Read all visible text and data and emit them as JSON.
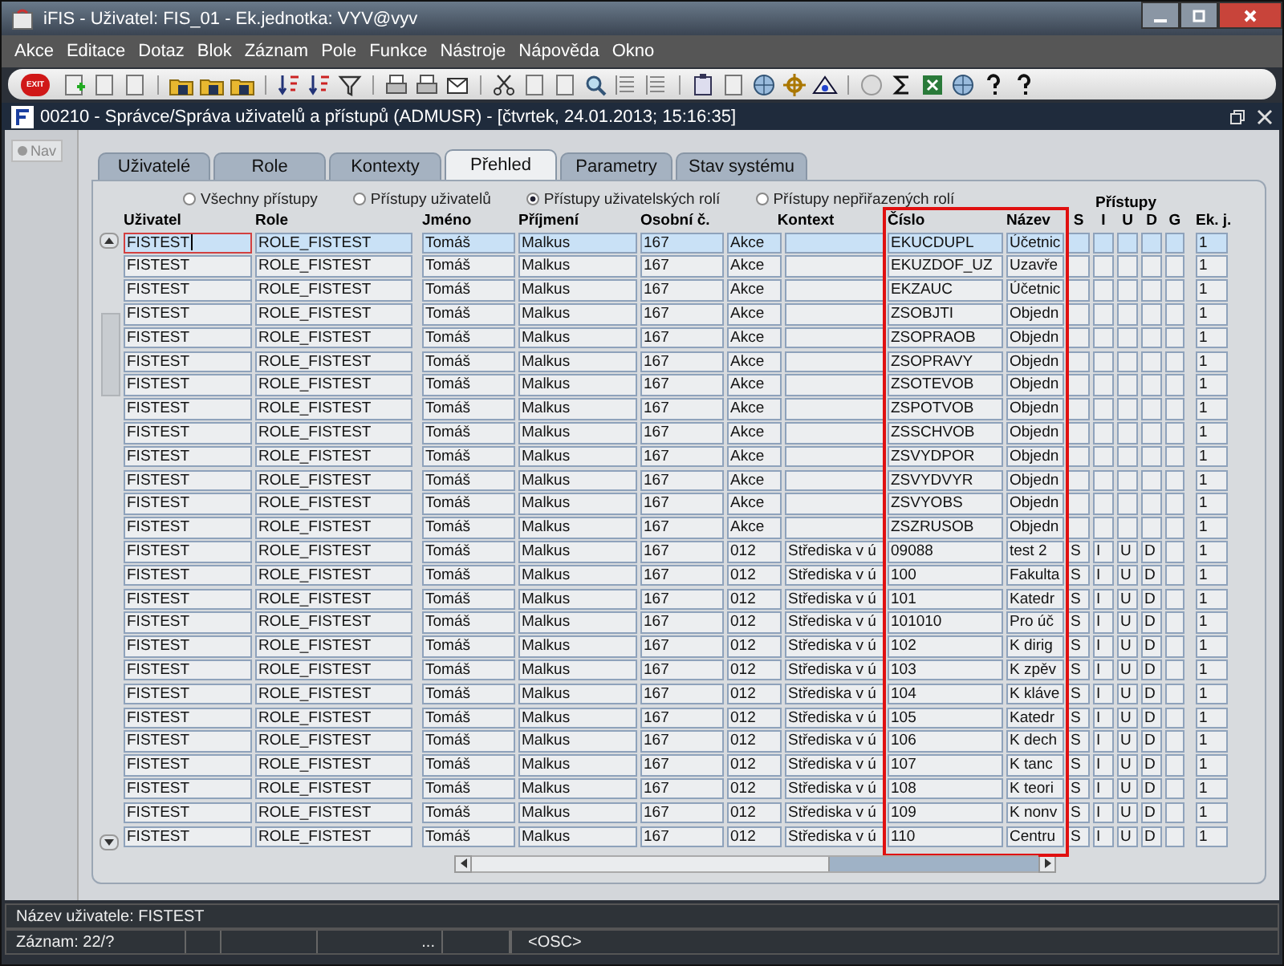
{
  "window": {
    "title": "iFIS - Uživatel: FIS_01 - Ek.jednotka: VYV@vyv"
  },
  "menu": [
    "Akce",
    "Editace",
    "Dotaz",
    "Blok",
    "Záznam",
    "Pole",
    "Funkce",
    "Nástroje",
    "Nápověda",
    "Okno"
  ],
  "toolbar": {
    "exit_label": "EXIT"
  },
  "form": {
    "title": "00210 - Správce/Správa uživatelů a přístupů (ADMUSR) - [čtvrtek, 24.01.2013; 15:16:35]",
    "nav": {
      "label": "Nav",
      "selected": true
    }
  },
  "tabs": [
    {
      "label": "Uživatelé",
      "selected": false
    },
    {
      "label": "Role",
      "selected": false
    },
    {
      "label": "Kontexty",
      "selected": false
    },
    {
      "label": "Přehled",
      "selected": true
    },
    {
      "label": "Parametry",
      "selected": false
    },
    {
      "label": "Stav systému",
      "selected": false
    }
  ],
  "filters": [
    {
      "label": "Všechny přístupy",
      "selected": false
    },
    {
      "label": "Přístupy uživatelů",
      "selected": false
    },
    {
      "label": "Přístupy uživatelských rolí",
      "selected": true
    },
    {
      "label": "Přístupy nepřiřazených rolí",
      "selected": false
    }
  ],
  "table": {
    "group_label": "Přístupy",
    "columns": [
      {
        "label": "Uživatel",
        "highlighted": false
      },
      {
        "label": "Role",
        "highlighted": false
      },
      {
        "label": "Jméno",
        "highlighted": false
      },
      {
        "label": "Příjmení",
        "highlighted": false
      },
      {
        "label": "Osobní č.",
        "highlighted": false
      },
      {
        "label": "Kontext",
        "highlighted": false
      },
      {
        "highlighted": false
      },
      {
        "label": "Číslo",
        "highlighted": true
      },
      {
        "label": "Název",
        "highlighted": true
      },
      {
        "label": "S",
        "highlighted": false
      },
      {
        "label": "I",
        "highlighted": false
      },
      {
        "label": "U",
        "highlighted": false
      },
      {
        "label": "D",
        "highlighted": false
      },
      {
        "label": "G",
        "highlighted": false
      },
      {
        "label": "Ek. j.",
        "highlighted": false
      }
    ],
    "rows": [
      {
        "selected": true,
        "focused": true,
        "user": "FISTEST",
        "role": "ROLE_FISTEST",
        "first": "Tomáš",
        "last": "Malkus",
        "pers": "167",
        "ctx": "Akce",
        "code": "EKUCDUPL",
        "name": "Účetnic",
        "unit": "1"
      },
      {
        "selected": false,
        "focused": false,
        "user": "FISTEST",
        "role": "ROLE_FISTEST",
        "first": "Tomáš",
        "last": "Malkus",
        "pers": "167",
        "ctx": "Akce",
        "code": "EKUZDOF_UZ",
        "name": "Uzavře",
        "unit": "1"
      },
      {
        "selected": false,
        "focused": false,
        "user": "FISTEST",
        "role": "ROLE_FISTEST",
        "first": "Tomáš",
        "last": "Malkus",
        "pers": "167",
        "ctx": "Akce",
        "code": "EKZAUC",
        "name": "Účetnic",
        "unit": "1"
      },
      {
        "selected": false,
        "focused": false,
        "user": "FISTEST",
        "role": "ROLE_FISTEST",
        "first": "Tomáš",
        "last": "Malkus",
        "pers": "167",
        "ctx": "Akce",
        "code": "ZSOBJTI",
        "name": "Objedn",
        "unit": "1"
      },
      {
        "selected": false,
        "focused": false,
        "user": "FISTEST",
        "role": "ROLE_FISTEST",
        "first": "Tomáš",
        "last": "Malkus",
        "pers": "167",
        "ctx": "Akce",
        "code": "ZSOPRAOB",
        "name": "Objedn",
        "unit": "1"
      },
      {
        "selected": false,
        "focused": false,
        "user": "FISTEST",
        "role": "ROLE_FISTEST",
        "first": "Tomáš",
        "last": "Malkus",
        "pers": "167",
        "ctx": "Akce",
        "code": "ZSOPRAVY",
        "name": "Objedn",
        "unit": "1"
      },
      {
        "selected": false,
        "focused": false,
        "user": "FISTEST",
        "role": "ROLE_FISTEST",
        "first": "Tomáš",
        "last": "Malkus",
        "pers": "167",
        "ctx": "Akce",
        "code": "ZSOTEVOB",
        "name": "Objedn",
        "unit": "1"
      },
      {
        "selected": false,
        "focused": false,
        "user": "FISTEST",
        "role": "ROLE_FISTEST",
        "first": "Tomáš",
        "last": "Malkus",
        "pers": "167",
        "ctx": "Akce",
        "code": "ZSPOTVOB",
        "name": "Objedn",
        "unit": "1"
      },
      {
        "selected": false,
        "focused": false,
        "user": "FISTEST",
        "role": "ROLE_FISTEST",
        "first": "Tomáš",
        "last": "Malkus",
        "pers": "167",
        "ctx": "Akce",
        "code": "ZSSCHVOB",
        "name": "Objedn",
        "unit": "1"
      },
      {
        "selected": false,
        "focused": false,
        "user": "FISTEST",
        "role": "ROLE_FISTEST",
        "first": "Tomáš",
        "last": "Malkus",
        "pers": "167",
        "ctx": "Akce",
        "code": "ZSVYDPOR",
        "name": "Objedn",
        "unit": "1"
      },
      {
        "selected": false,
        "focused": false,
        "user": "FISTEST",
        "role": "ROLE_FISTEST",
        "first": "Tomáš",
        "last": "Malkus",
        "pers": "167",
        "ctx": "Akce",
        "code": "ZSVYDVYR",
        "name": "Objedn",
        "unit": "1"
      },
      {
        "selected": false,
        "focused": false,
        "user": "FISTEST",
        "role": "ROLE_FISTEST",
        "first": "Tomáš",
        "last": "Malkus",
        "pers": "167",
        "ctx": "Akce",
        "code": "ZSVYOBS",
        "name": "Objedn",
        "unit": "1"
      },
      {
        "selected": false,
        "focused": false,
        "user": "FISTEST",
        "role": "ROLE_FISTEST",
        "first": "Tomáš",
        "last": "Malkus",
        "pers": "167",
        "ctx": "Akce",
        "code": "ZSZRUSOB",
        "name": "Objedn",
        "unit": "1"
      },
      {
        "selected": false,
        "focused": false,
        "user": "FISTEST",
        "role": "ROLE_FISTEST",
        "first": "Tomáš",
        "last": "Malkus",
        "pers": "167",
        "ctx": "012",
        "ctxn": "Střediska v ú",
        "code": "09088",
        "name": "test 2",
        "s": "S",
        "i": "I",
        "u": "U",
        "d": "D",
        "unit": "1"
      },
      {
        "selected": false,
        "focused": false,
        "user": "FISTEST",
        "role": "ROLE_FISTEST",
        "first": "Tomáš",
        "last": "Malkus",
        "pers": "167",
        "ctx": "012",
        "ctxn": "Střediska v ú",
        "code": "100",
        "name": "Fakulta",
        "s": "S",
        "i": "I",
        "u": "U",
        "d": "D",
        "unit": "1"
      },
      {
        "selected": false,
        "focused": false,
        "user": "FISTEST",
        "role": "ROLE_FISTEST",
        "first": "Tomáš",
        "last": "Malkus",
        "pers": "167",
        "ctx": "012",
        "ctxn": "Střediska v ú",
        "code": "101",
        "name": "Katedr",
        "s": "S",
        "i": "I",
        "u": "U",
        "d": "D",
        "unit": "1"
      },
      {
        "selected": false,
        "focused": false,
        "user": "FISTEST",
        "role": "ROLE_FISTEST",
        "first": "Tomáš",
        "last": "Malkus",
        "pers": "167",
        "ctx": "012",
        "ctxn": "Střediska v ú",
        "code": "101010",
        "name": "Pro úč",
        "s": "S",
        "i": "I",
        "u": "U",
        "d": "D",
        "unit": "1"
      },
      {
        "selected": false,
        "focused": false,
        "user": "FISTEST",
        "role": "ROLE_FISTEST",
        "first": "Tomáš",
        "last": "Malkus",
        "pers": "167",
        "ctx": "012",
        "ctxn": "Střediska v ú",
        "code": "102",
        "name": "K dirig",
        "s": "S",
        "i": "I",
        "u": "U",
        "d": "D",
        "unit": "1"
      },
      {
        "selected": false,
        "focused": false,
        "user": "FISTEST",
        "role": "ROLE_FISTEST",
        "first": "Tomáš",
        "last": "Malkus",
        "pers": "167",
        "ctx": "012",
        "ctxn": "Střediska v ú",
        "code": "103",
        "name": "K zpěv",
        "s": "S",
        "i": "I",
        "u": "U",
        "d": "D",
        "unit": "1"
      },
      {
        "selected": false,
        "focused": false,
        "user": "FISTEST",
        "role": "ROLE_FISTEST",
        "first": "Tomáš",
        "last": "Malkus",
        "pers": "167",
        "ctx": "012",
        "ctxn": "Střediska v ú",
        "code": "104",
        "name": "K kláve",
        "s": "S",
        "i": "I",
        "u": "U",
        "d": "D",
        "unit": "1"
      },
      {
        "selected": false,
        "focused": false,
        "user": "FISTEST",
        "role": "ROLE_FISTEST",
        "first": "Tomáš",
        "last": "Malkus",
        "pers": "167",
        "ctx": "012",
        "ctxn": "Střediska v ú",
        "code": "105",
        "name": "Katedr",
        "s": "S",
        "i": "I",
        "u": "U",
        "d": "D",
        "unit": "1"
      },
      {
        "selected": false,
        "focused": false,
        "user": "FISTEST",
        "role": "ROLE_FISTEST",
        "first": "Tomáš",
        "last": "Malkus",
        "pers": "167",
        "ctx": "012",
        "ctxn": "Střediska v ú",
        "code": "106",
        "name": "K dech",
        "s": "S",
        "i": "I",
        "u": "U",
        "d": "D",
        "unit": "1"
      },
      {
        "selected": false,
        "focused": false,
        "user": "FISTEST",
        "role": "ROLE_FISTEST",
        "first": "Tomáš",
        "last": "Malkus",
        "pers": "167",
        "ctx": "012",
        "ctxn": "Střediska v ú",
        "code": "107",
        "name": "K tanc",
        "s": "S",
        "i": "I",
        "u": "U",
        "d": "D",
        "unit": "1"
      },
      {
        "selected": false,
        "focused": false,
        "user": "FISTEST",
        "role": "ROLE_FISTEST",
        "first": "Tomáš",
        "last": "Malkus",
        "pers": "167",
        "ctx": "012",
        "ctxn": "Střediska v ú",
        "code": "108",
        "name": "K teori",
        "s": "S",
        "i": "I",
        "u": "U",
        "d": "D",
        "unit": "1"
      },
      {
        "selected": false,
        "focused": false,
        "user": "FISTEST",
        "role": "ROLE_FISTEST",
        "first": "Tomáš",
        "last": "Malkus",
        "pers": "167",
        "ctx": "012",
        "ctxn": "Střediska v ú",
        "code": "109",
        "name": "K nonv",
        "s": "S",
        "i": "I",
        "u": "U",
        "d": "D",
        "unit": "1"
      },
      {
        "selected": false,
        "focused": false,
        "user": "FISTEST",
        "role": "ROLE_FISTEST",
        "first": "Tomáš",
        "last": "Malkus",
        "pers": "167",
        "ctx": "012",
        "ctxn": "Střediska v ú",
        "code": "110",
        "name": "Centru",
        "s": "S",
        "i": "I",
        "u": "U",
        "d": "D",
        "unit": "1"
      }
    ]
  },
  "status": {
    "hint": "Název uživatele: FISTEST",
    "record": "Záznam: 22/?",
    "ellipsis": "...",
    "mode": "<OSC>"
  }
}
